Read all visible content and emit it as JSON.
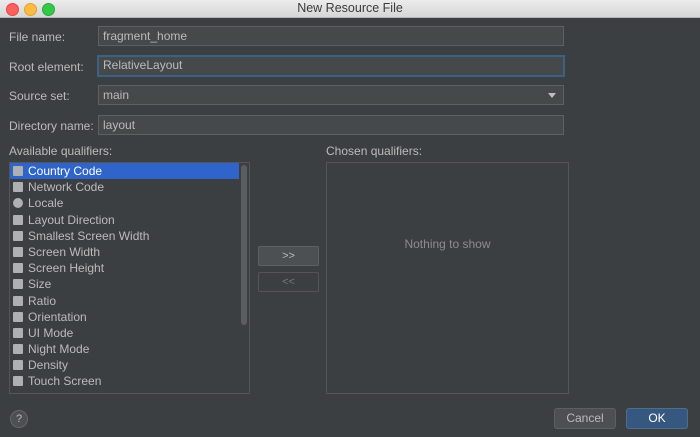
{
  "window": {
    "title": "New Resource File"
  },
  "form": {
    "file_name": {
      "label": "File name:",
      "value": "fragment_home"
    },
    "root_element": {
      "label": "Root element:",
      "value": "RelativeLayout"
    },
    "source_set": {
      "label": "Source set:",
      "value": "main"
    },
    "directory_name": {
      "label": "Directory name:",
      "value": "layout"
    }
  },
  "qualifiers": {
    "available_label": "Available qualifiers:",
    "chosen_label": "Chosen qualifiers:",
    "empty_text": "Nothing to show",
    "items": [
      {
        "label": "Country Code",
        "icon": "flag-icon"
      },
      {
        "label": "Network Code",
        "icon": "network-icon"
      },
      {
        "label": "Locale",
        "icon": "globe-icon"
      },
      {
        "label": "Layout Direction",
        "icon": "layout-direction-icon"
      },
      {
        "label": "Smallest Screen Width",
        "icon": "smallest-screen-width-icon"
      },
      {
        "label": "Screen Width",
        "icon": "screen-width-icon"
      },
      {
        "label": "Screen Height",
        "icon": "screen-height-icon"
      },
      {
        "label": "Size",
        "icon": "size-icon"
      },
      {
        "label": "Ratio",
        "icon": "ratio-icon"
      },
      {
        "label": "Orientation",
        "icon": "orientation-icon"
      },
      {
        "label": "UI Mode",
        "icon": "ui-mode-icon"
      },
      {
        "label": "Night Mode",
        "icon": "night-mode-icon"
      },
      {
        "label": "Density",
        "icon": "density-icon"
      },
      {
        "label": "Touch Screen",
        "icon": "touch-screen-icon"
      }
    ]
  },
  "buttons": {
    "add": ">>",
    "remove": "<<",
    "help": "?",
    "cancel": "Cancel",
    "ok": "OK"
  },
  "colors": {
    "selection": "#2f65ca",
    "ok_button": "#365880",
    "focus_border": "#3d6185"
  }
}
